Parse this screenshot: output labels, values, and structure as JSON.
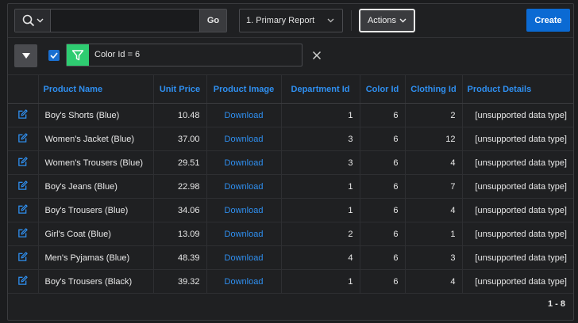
{
  "toolbar": {
    "search_value": "",
    "go_label": "Go",
    "report_label": "1. Primary Report",
    "actions_label": "Actions",
    "create_label": "Create"
  },
  "filter": {
    "enabled": true,
    "text": "Color Id = 6"
  },
  "table": {
    "headers": {
      "product_name": "Product Name",
      "unit_price": "Unit Price",
      "product_image": "Product Image",
      "department_id": "Department Id",
      "color_id": "Color Id",
      "clothing_id": "Clothing Id",
      "product_details": "Product Details"
    },
    "rows": [
      {
        "name": "Boy's Shorts (Blue)",
        "price": "10.48",
        "image": "Download",
        "dept": "1",
        "color": "6",
        "clothing": "2",
        "details": "[unsupported data type]"
      },
      {
        "name": "Women's Jacket (Blue)",
        "price": "37.00",
        "image": "Download",
        "dept": "3",
        "color": "6",
        "clothing": "12",
        "details": "[unsupported data type]"
      },
      {
        "name": "Women's Trousers (Blue)",
        "price": "29.51",
        "image": "Download",
        "dept": "3",
        "color": "6",
        "clothing": "4",
        "details": "[unsupported data type]"
      },
      {
        "name": "Boy's Jeans (Blue)",
        "price": "22.98",
        "image": "Download",
        "dept": "1",
        "color": "6",
        "clothing": "7",
        "details": "[unsupported data type]"
      },
      {
        "name": "Boy's Trousers (Blue)",
        "price": "34.06",
        "image": "Download",
        "dept": "1",
        "color": "6",
        "clothing": "4",
        "details": "[unsupported data type]"
      },
      {
        "name": "Girl's Coat (Blue)",
        "price": "13.09",
        "image": "Download",
        "dept": "2",
        "color": "6",
        "clothing": "1",
        "details": "[unsupported data type]"
      },
      {
        "name": "Men's Pyjamas (Blue)",
        "price": "48.39",
        "image": "Download",
        "dept": "4",
        "color": "6",
        "clothing": "3",
        "details": "[unsupported data type]"
      },
      {
        "name": "Boy's Trousers (Black)",
        "price": "39.32",
        "image": "Download",
        "dept": "1",
        "color": "6",
        "clothing": "4",
        "details": "[unsupported data type]"
      }
    ]
  },
  "pagination": "1 - 8",
  "icons": {
    "search": "search-icon",
    "chevron": "chevron-down-icon",
    "collapse": "triangle-down-icon",
    "filter": "filter-icon",
    "remove": "close-icon",
    "edit": "edit-icon"
  },
  "colors": {
    "accent": "#2f8ff0",
    "primary_button": "#0b6ad3",
    "filter_icon_bg": "#2ecc71",
    "background": "#1b1c1e"
  }
}
